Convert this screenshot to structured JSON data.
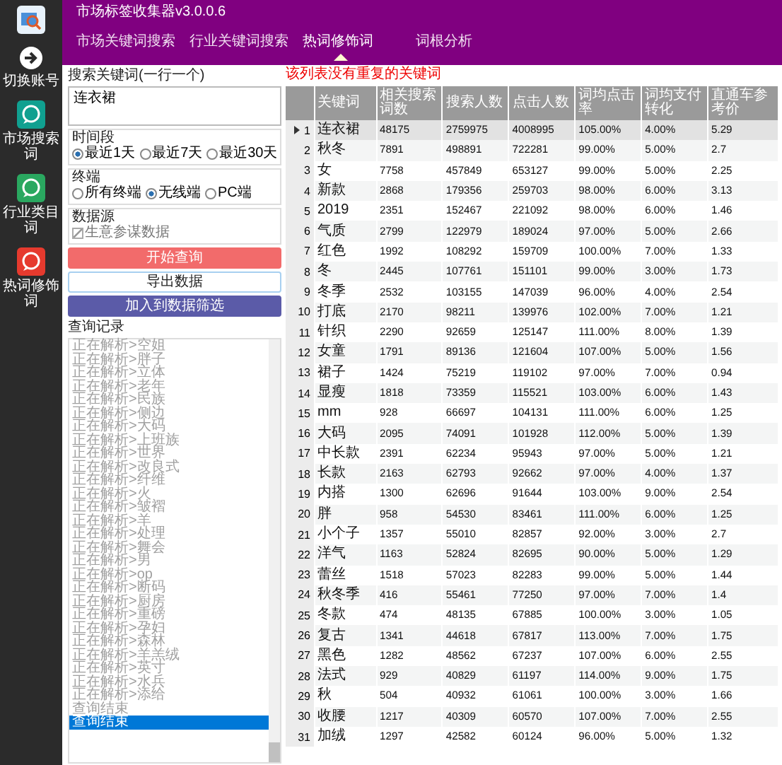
{
  "app": {
    "title": "市场标签收集器v3.0.0.6"
  },
  "sidebar": [
    {
      "label": "切换账号",
      "kind": "account"
    },
    {
      "label": "市场搜索词",
      "kind": "teal"
    },
    {
      "label": "行业类目词",
      "kind": "green"
    },
    {
      "label": "热词修饰词",
      "kind": "red"
    }
  ],
  "tabs": [
    {
      "label": "市场关键词搜索",
      "selected": false
    },
    {
      "label": "行业关键词搜索",
      "selected": false
    },
    {
      "label": "热词修饰词",
      "selected": true
    },
    {
      "label": "词根分析",
      "selected": false
    }
  ],
  "notice": "该列表没有重复的关键词",
  "search": {
    "label": "搜索关键词(一行一个)",
    "value": "连衣裙"
  },
  "time_range": {
    "label": "时间段",
    "options": [
      {
        "label": "最近1天",
        "selected": true
      },
      {
        "label": "最近7天",
        "selected": false
      },
      {
        "label": "最近30天",
        "selected": false
      }
    ]
  },
  "terminal": {
    "label": "终端",
    "options": [
      {
        "label": "所有终端",
        "selected": false
      },
      {
        "label": "无线端",
        "selected": true
      },
      {
        "label": "PC端",
        "selected": false
      }
    ]
  },
  "data_source": {
    "label": "数据源",
    "option": {
      "label": "生意参谋数据",
      "checked": true,
      "disabled": true
    }
  },
  "buttons": [
    {
      "label": "开始查询",
      "kind": "primary"
    },
    {
      "label": "导出数据",
      "kind": "outline"
    },
    {
      "label": "加入到数据筛选",
      "kind": "secondary"
    }
  ],
  "history": {
    "label": "查询记录",
    "items": [
      {
        "text": "正在解析>空姐",
        "selected": false
      },
      {
        "text": "正在解析>胖子",
        "selected": false
      },
      {
        "text": "正在解析>立体",
        "selected": false
      },
      {
        "text": "正在解析>老年",
        "selected": false
      },
      {
        "text": "正在解析>民族",
        "selected": false
      },
      {
        "text": "正在解析>侧边",
        "selected": false
      },
      {
        "text": "正在解析>大码",
        "selected": false
      },
      {
        "text": "正在解析>上班族",
        "selected": false
      },
      {
        "text": "正在解析>世界",
        "selected": false
      },
      {
        "text": "正在解析>改良式",
        "selected": false
      },
      {
        "text": "正在解析>纤维",
        "selected": false
      },
      {
        "text": "正在解析>火",
        "selected": false
      },
      {
        "text": "正在解析>皱褶",
        "selected": false
      },
      {
        "text": "正在解析>羊",
        "selected": false
      },
      {
        "text": "正在解析>处理",
        "selected": false
      },
      {
        "text": "正在解析>舞会",
        "selected": false
      },
      {
        "text": "正在解析>男",
        "selected": false
      },
      {
        "text": "正在解析>op",
        "selected": false
      },
      {
        "text": "正在解析>断码",
        "selected": false
      },
      {
        "text": "正在解析>厨房",
        "selected": false
      },
      {
        "text": "正在解析>重磅",
        "selected": false
      },
      {
        "text": "正在解析>孕妇",
        "selected": false
      },
      {
        "text": "正在解析>森林",
        "selected": false
      },
      {
        "text": "正在解析>羊羔绒",
        "selected": false
      },
      {
        "text": "正在解析>英寸",
        "selected": false
      },
      {
        "text": "正在解析>水兵",
        "selected": false
      },
      {
        "text": "正在解析>添给",
        "selected": false
      },
      {
        "text": "查询结束",
        "selected": false
      },
      {
        "text": "查询结束",
        "selected": true
      }
    ]
  },
  "table": {
    "columns": [
      "关键词",
      "相关搜索词数",
      "搜索人数",
      "点击人数",
      "词均点击率",
      "词均支付转化",
      "直通车参考价"
    ],
    "rows": [
      {
        "no": "1",
        "cells": [
          "连衣裙",
          "48175",
          "2759975",
          "4008995",
          "105.00%",
          "4.00%",
          "5.29"
        ],
        "selected": true
      },
      {
        "no": "2",
        "cells": [
          "秋冬",
          "7891",
          "498891",
          "722281",
          "99.00%",
          "5.00%",
          "2.7"
        ],
        "selected": false
      },
      {
        "no": "3",
        "cells": [
          "女",
          "7758",
          "457849",
          "653127",
          "99.00%",
          "5.00%",
          "2.25"
        ],
        "selected": false
      },
      {
        "no": "4",
        "cells": [
          "新款",
          "2868",
          "179356",
          "259703",
          "98.00%",
          "6.00%",
          "3.13"
        ],
        "selected": false
      },
      {
        "no": "5",
        "cells": [
          "2019",
          "2351",
          "152467",
          "221092",
          "98.00%",
          "6.00%",
          "1.46"
        ],
        "selected": false
      },
      {
        "no": "6",
        "cells": [
          "气质",
          "2799",
          "122979",
          "189024",
          "97.00%",
          "5.00%",
          "2.66"
        ],
        "selected": false
      },
      {
        "no": "7",
        "cells": [
          "红色",
          "1992",
          "108292",
          "159709",
          "100.00%",
          "7.00%",
          "1.33"
        ],
        "selected": false
      },
      {
        "no": "8",
        "cells": [
          "冬",
          "2445",
          "107761",
          "151101",
          "99.00%",
          "3.00%",
          "1.73"
        ],
        "selected": false
      },
      {
        "no": "9",
        "cells": [
          "冬季",
          "2532",
          "103155",
          "147039",
          "96.00%",
          "4.00%",
          "2.54"
        ],
        "selected": false
      },
      {
        "no": "10",
        "cells": [
          "打底",
          "2170",
          "98211",
          "139976",
          "102.00%",
          "7.00%",
          "1.21"
        ],
        "selected": false
      },
      {
        "no": "11",
        "cells": [
          "针织",
          "2290",
          "92659",
          "125147",
          "111.00%",
          "8.00%",
          "1.39"
        ],
        "selected": false
      },
      {
        "no": "12",
        "cells": [
          "女童",
          "1791",
          "89136",
          "121604",
          "107.00%",
          "5.00%",
          "1.56"
        ],
        "selected": false
      },
      {
        "no": "13",
        "cells": [
          "裙子",
          "1424",
          "75219",
          "119102",
          "97.00%",
          "7.00%",
          "0.94"
        ],
        "selected": false
      },
      {
        "no": "14",
        "cells": [
          "显瘦",
          "1818",
          "73359",
          "115521",
          "103.00%",
          "6.00%",
          "1.43"
        ],
        "selected": false
      },
      {
        "no": "15",
        "cells": [
          "mm",
          "928",
          "66697",
          "104131",
          "111.00%",
          "6.00%",
          "1.25"
        ],
        "selected": false
      },
      {
        "no": "16",
        "cells": [
          "大码",
          "2095",
          "74091",
          "101928",
          "112.00%",
          "5.00%",
          "1.39"
        ],
        "selected": false
      },
      {
        "no": "17",
        "cells": [
          "中长款",
          "2391",
          "62234",
          "95943",
          "97.00%",
          "5.00%",
          "1.21"
        ],
        "selected": false
      },
      {
        "no": "18",
        "cells": [
          "长款",
          "2163",
          "62793",
          "92662",
          "97.00%",
          "4.00%",
          "1.37"
        ],
        "selected": false
      },
      {
        "no": "19",
        "cells": [
          "内搭",
          "1300",
          "62696",
          "91644",
          "103.00%",
          "9.00%",
          "2.54"
        ],
        "selected": false
      },
      {
        "no": "20",
        "cells": [
          "胖",
          "958",
          "54530",
          "83461",
          "111.00%",
          "6.00%",
          "1.25"
        ],
        "selected": false
      },
      {
        "no": "21",
        "cells": [
          "小个子",
          "1357",
          "55010",
          "82857",
          "92.00%",
          "3.00%",
          "2.7"
        ],
        "selected": false
      },
      {
        "no": "22",
        "cells": [
          "洋气",
          "1163",
          "52824",
          "82695",
          "90.00%",
          "5.00%",
          "1.29"
        ],
        "selected": false
      },
      {
        "no": "23",
        "cells": [
          "蕾丝",
          "1518",
          "57023",
          "82283",
          "99.00%",
          "5.00%",
          "1.44"
        ],
        "selected": false
      },
      {
        "no": "24",
        "cells": [
          "秋冬季",
          "416",
          "55461",
          "77250",
          "97.00%",
          "7.00%",
          "1.4"
        ],
        "selected": false
      },
      {
        "no": "25",
        "cells": [
          "冬款",
          "474",
          "48135",
          "67885",
          "100.00%",
          "3.00%",
          "1.05"
        ],
        "selected": false
      },
      {
        "no": "26",
        "cells": [
          "复古",
          "1341",
          "44618",
          "67817",
          "113.00%",
          "7.00%",
          "1.75"
        ],
        "selected": false
      },
      {
        "no": "27",
        "cells": [
          "黑色",
          "1282",
          "48562",
          "67237",
          "107.00%",
          "6.00%",
          "2.55"
        ],
        "selected": false
      },
      {
        "no": "28",
        "cells": [
          "法式",
          "929",
          "40829",
          "61197",
          "114.00%",
          "9.00%",
          "1.75"
        ],
        "selected": false
      },
      {
        "no": "29",
        "cells": [
          "秋",
          "504",
          "40932",
          "61061",
          "100.00%",
          "3.00%",
          "1.66"
        ],
        "selected": false
      },
      {
        "no": "30",
        "cells": [
          "收腰",
          "1217",
          "40309",
          "60570",
          "107.00%",
          "7.00%",
          "2.55"
        ],
        "selected": false
      },
      {
        "no": "31",
        "cells": [
          "加绒",
          "1297",
          "42582",
          "60124",
          "96.00%",
          "5.00%",
          "1.32"
        ],
        "selected": false
      }
    ]
  }
}
